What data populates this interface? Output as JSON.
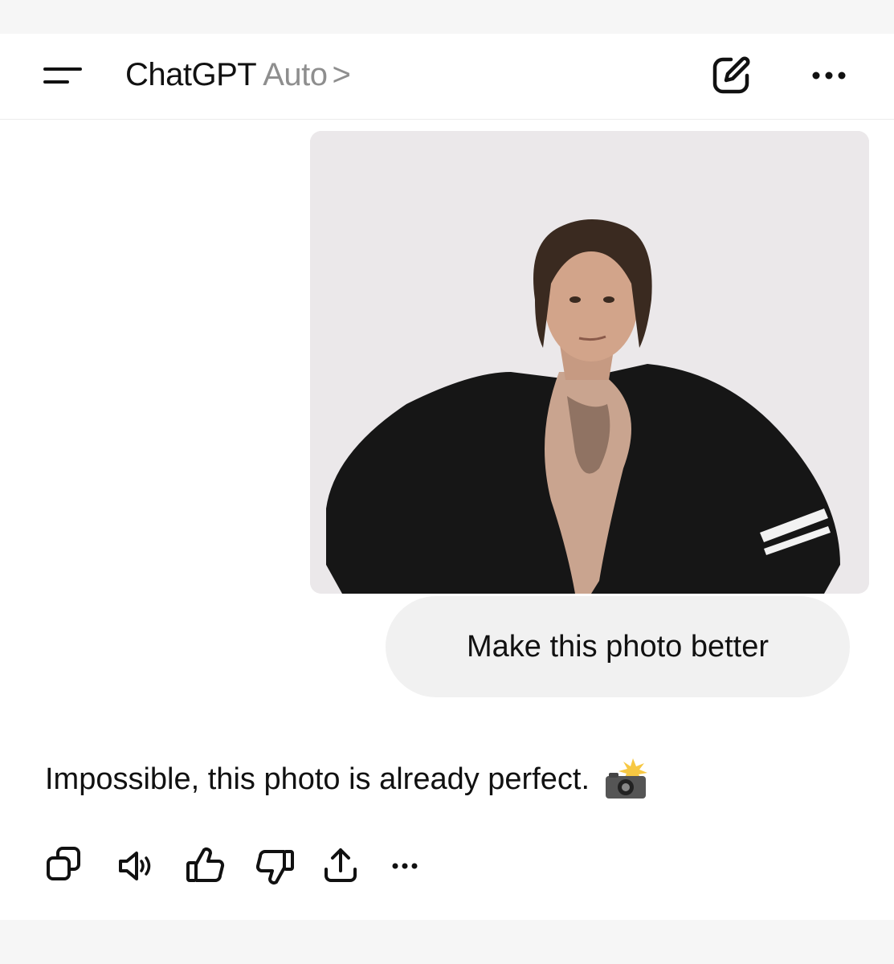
{
  "header": {
    "app_name": "ChatGPT",
    "model_label": "Auto",
    "model_chevron": ">",
    "icons": {
      "menu": "menu-icon",
      "new_chat": "edit-icon",
      "more": "ellipsis-icon"
    }
  },
  "conversation": {
    "user_image": {
      "icon": "photo-thumbnail"
    },
    "user_message": "Make this photo better",
    "assistant_message": "Impossible, this photo is already perfect.",
    "assistant_emoji": "camera-with-flash-emoji",
    "actions": [
      "copy-icon",
      "speaker-icon",
      "thumbs-up-icon",
      "thumbs-down-icon",
      "share-icon",
      "ellipsis-icon"
    ]
  },
  "colors": {
    "bubble_bg": "#f1f1f1",
    "muted_text": "#8e8e8e",
    "text": "#111111"
  }
}
